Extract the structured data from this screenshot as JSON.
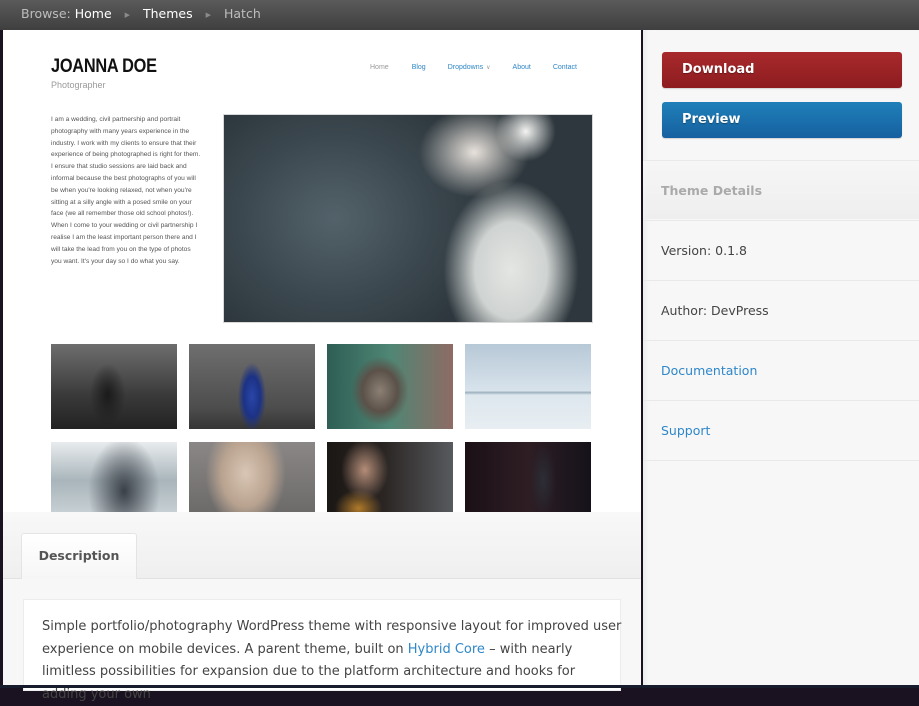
{
  "breadcrumb": {
    "prefix": "Browse:",
    "items": [
      {
        "label": "Home"
      },
      {
        "label": "Themes"
      },
      {
        "label": "Hatch"
      }
    ]
  },
  "preview": {
    "site_title": "JOANNA DOE",
    "site_tagline": "Photographer",
    "nav": [
      {
        "label": "Home"
      },
      {
        "label": "Blog"
      },
      {
        "label": "Dropdowns"
      },
      {
        "label": "About"
      },
      {
        "label": "Contact"
      }
    ],
    "dropdown_indicator": "∨",
    "bio": "I am a wedding, civil partnership and portrait photography with many years experience in the industry. I work with my clients to ensure that their experience of being photographed is right for them. I ensure that studio sessions are laid back and informal because the best photographs of you will be when you're looking relaxed, not when you're sitting at a silly angle with a posed smile on your face (we all remember those old school photos!). When I come to your wedding or civil partnership I realise I am the least important person there and I will take the lead from you on the type of photos you want. It's your day so I do what you say.",
    "hero_image": "woman-in-white-dress-photo",
    "thumbnails": [
      {
        "subject": "woman-painting-at-easel"
      },
      {
        "subject": "woman-in-blue-gown"
      },
      {
        "subject": "kitten"
      },
      {
        "subject": "snowy-landscape"
      },
      {
        "subject": "woman-by-tree-in-mist"
      },
      {
        "subject": "face-wrapped-in-gauze"
      },
      {
        "subject": "woman-with-dark-hair"
      },
      {
        "subject": "woman-in-dark-room"
      }
    ]
  },
  "description": {
    "tab_label": "Description",
    "text_before_link": "Simple portfolio/photography WordPress theme with responsive layout for improved user experience on mobile devices. A parent theme, built on ",
    "link_label": "Hybrid Core",
    "text_after_link": " – with nearly limitless possibilities for expansion due to the platform architecture and hooks for adding your own"
  },
  "sidebar": {
    "download_label": "Download",
    "preview_label": "Preview",
    "details_heading": "Theme Details",
    "version": "Version: 0.1.8",
    "author": "Author: DevPress",
    "documentation_label": "Documentation",
    "support_label": "Support"
  },
  "colors": {
    "download": "#9c2326",
    "preview": "#1a70ac",
    "link": "#2e87c8"
  }
}
